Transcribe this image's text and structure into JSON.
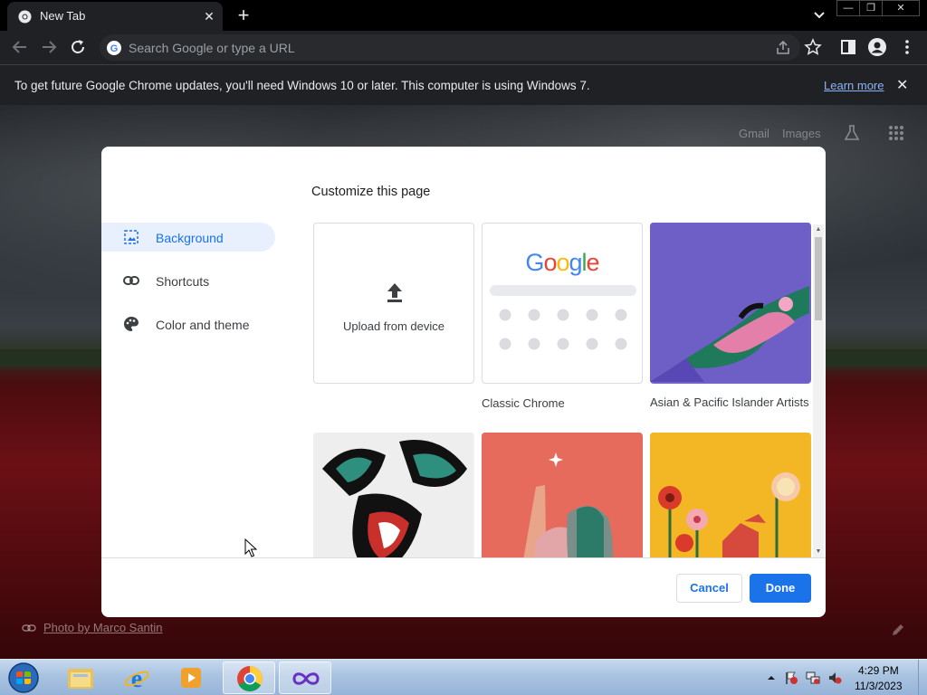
{
  "tab": {
    "title": "New Tab",
    "close_glyph": "✕",
    "new_tab_glyph": "+"
  },
  "window_controls": {
    "minimize": "—",
    "restore": "❐",
    "close": "✕"
  },
  "omnibox": {
    "placeholder": "Search Google or type a URL"
  },
  "infobar": {
    "message": "To get future Google Chrome updates, you'll need Windows 10 or later. This computer is using Windows 7.",
    "link": "Learn more",
    "close_glyph": "✕"
  },
  "ntp": {
    "links": {
      "gmail": "Gmail",
      "images": "Images"
    },
    "photo_credit": "Photo by Marco Santin"
  },
  "dialog": {
    "heading": "Customize this page",
    "sidebar": [
      {
        "label": "Background",
        "icon": "image-icon",
        "active": true
      },
      {
        "label": "Shortcuts",
        "icon": "link-icon",
        "active": false
      },
      {
        "label": "Color and theme",
        "icon": "palette-icon",
        "active": false
      }
    ],
    "tiles": {
      "upload": "Upload from device",
      "classic": "Classic Chrome",
      "classic_logo": "Google",
      "asian_pacific": "Asian & Pacific Islander Artists"
    },
    "buttons": {
      "cancel": "Cancel",
      "done": "Done"
    }
  },
  "taskbar": {
    "time": "4:29 PM",
    "date": "11/3/2023",
    "apps": [
      "windows-explorer",
      "internet-explorer",
      "media-player",
      "google-chrome",
      "visual-studio"
    ]
  },
  "colors": {
    "accent": "#1a73e8",
    "chrome_dark": "#202124",
    "active_nav_bg": "#e8f0fe"
  }
}
